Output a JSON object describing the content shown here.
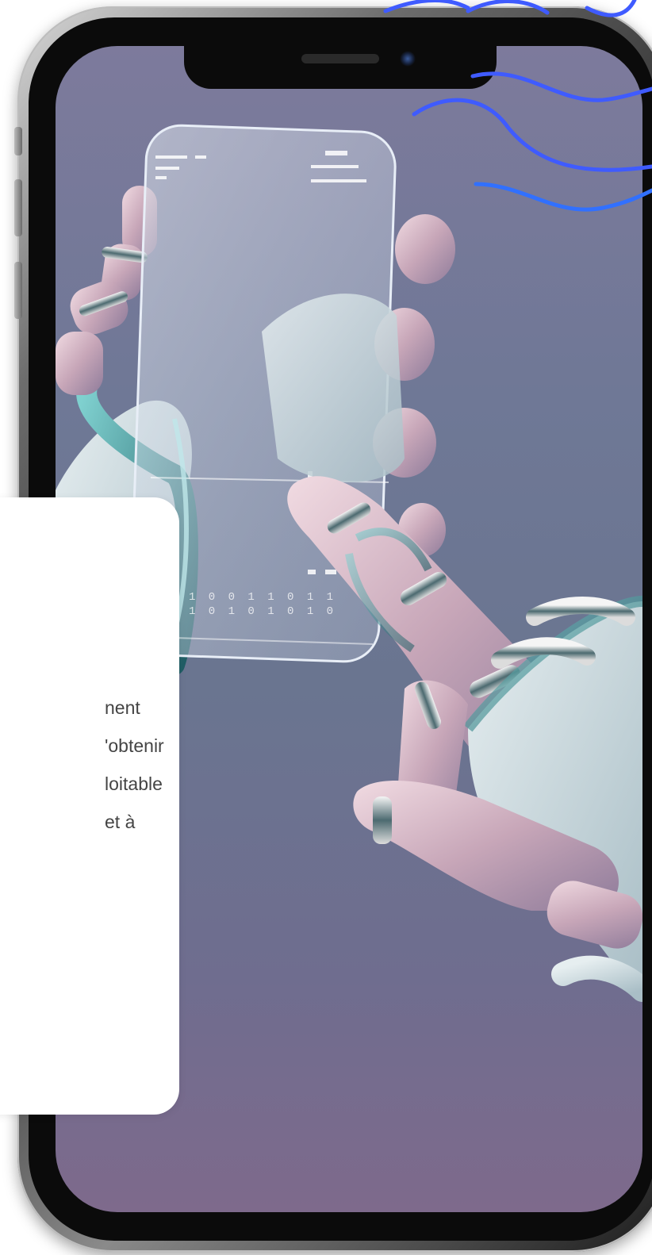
{
  "phone": {
    "frame_color": "#1c1c1c",
    "screen_colors": [
      "#7d7a9c",
      "#6a7590",
      "#7e6a8c"
    ],
    "camera_color": "#3b5b9a"
  },
  "decoration": {
    "squiggle_color": "#3f5bff",
    "squiggle_color_alt": "#2f6bff"
  },
  "hero_image": {
    "subject": "robot-hands-holding-transparent-phone",
    "screen_readout_line_1": "1 0 0 1 1 0 1 1",
    "screen_readout_line_2": "1 0 1 0 1 0 1 0"
  },
  "info_card": {
    "lines": [
      "nent",
      "'obtenir",
      "loitable",
      "et à"
    ]
  }
}
